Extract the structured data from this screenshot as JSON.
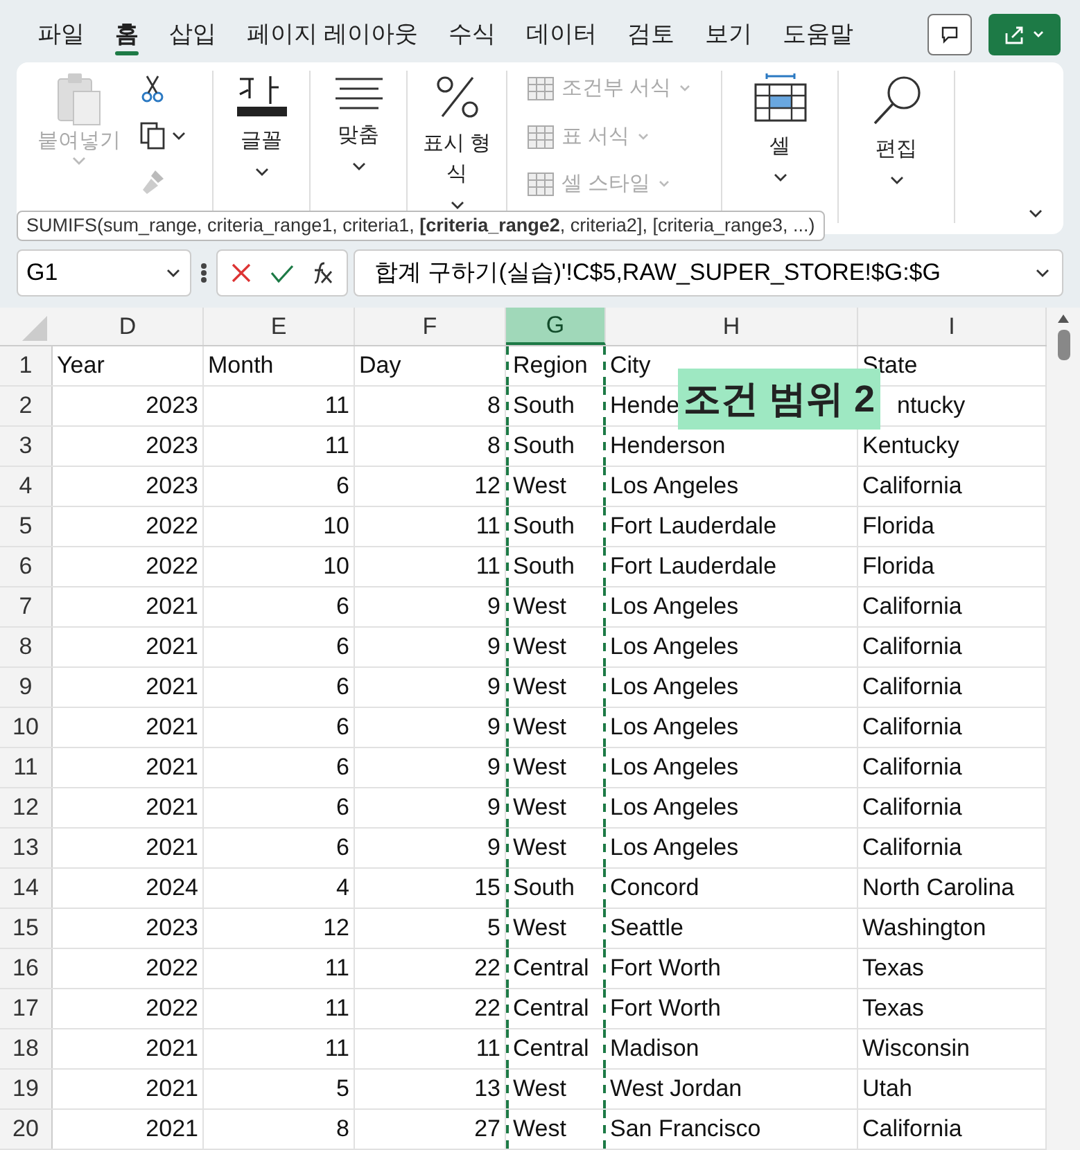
{
  "menu_tabs": [
    {
      "label": "파일",
      "selected": false
    },
    {
      "label": "홈",
      "selected": true
    },
    {
      "label": "삽입",
      "selected": false
    },
    {
      "label": "페이지 레이아웃",
      "selected": false
    },
    {
      "label": "수식",
      "selected": false
    },
    {
      "label": "데이터",
      "selected": false
    },
    {
      "label": "검토",
      "selected": false
    },
    {
      "label": "보기",
      "selected": false
    },
    {
      "label": "도움말",
      "selected": false
    }
  ],
  "ribbon": {
    "paste": {
      "label": "붙여넣기",
      "disabled": true
    },
    "groups": [
      {
        "label": "글꼴"
      },
      {
        "label": "맞춤"
      },
      {
        "label": "표시 형식"
      }
    ],
    "styles": [
      {
        "label": "조건부 서식",
        "disabled": true
      },
      {
        "label": "표 서식",
        "disabled": true
      },
      {
        "label": "셀 스타일",
        "disabled": true
      }
    ],
    "right_groups": [
      {
        "label": "셀"
      },
      {
        "label": "편집"
      }
    ]
  },
  "tooltip": "SUMIFS(sum_range, criteria_range1, criteria1, **[criteria_range2**, criteria2], [criteria_range3, ...)",
  "name_box": "G1",
  "formula": "합계 구하기(실습)'!C$5,RAW_SUPER_STORE!$G:$G",
  "columns": [
    {
      "label": "D",
      "selected": false
    },
    {
      "label": "E",
      "selected": false
    },
    {
      "label": "F",
      "selected": false
    },
    {
      "label": "G",
      "selected": true
    },
    {
      "label": "H",
      "selected": false
    },
    {
      "label": "I",
      "selected": false
    }
  ],
  "rows": [
    {
      "n": "1",
      "cells": [
        "Year",
        "Month",
        "Day",
        "Region",
        "City",
        "State"
      ]
    },
    {
      "n": "2",
      "cells": [
        "2023",
        "11",
        "8",
        "South",
        "Hende",
        "ntucky"
      ]
    },
    {
      "n": "3",
      "cells": [
        "2023",
        "11",
        "8",
        "South",
        "Henderson",
        "Kentucky"
      ]
    },
    {
      "n": "4",
      "cells": [
        "2023",
        "6",
        "12",
        "West",
        "Los Angeles",
        "California"
      ]
    },
    {
      "n": "5",
      "cells": [
        "2022",
        "10",
        "11",
        "South",
        "Fort Lauderdale",
        "Florida"
      ]
    },
    {
      "n": "6",
      "cells": [
        "2022",
        "10",
        "11",
        "South",
        "Fort Lauderdale",
        "Florida"
      ]
    },
    {
      "n": "7",
      "cells": [
        "2021",
        "6",
        "9",
        "West",
        "Los Angeles",
        "California"
      ]
    },
    {
      "n": "8",
      "cells": [
        "2021",
        "6",
        "9",
        "West",
        "Los Angeles",
        "California"
      ]
    },
    {
      "n": "9",
      "cells": [
        "2021",
        "6",
        "9",
        "West",
        "Los Angeles",
        "California"
      ]
    },
    {
      "n": "10",
      "cells": [
        "2021",
        "6",
        "9",
        "West",
        "Los Angeles",
        "California"
      ]
    },
    {
      "n": "11",
      "cells": [
        "2021",
        "6",
        "9",
        "West",
        "Los Angeles",
        "California"
      ]
    },
    {
      "n": "12",
      "cells": [
        "2021",
        "6",
        "9",
        "West",
        "Los Angeles",
        "California"
      ]
    },
    {
      "n": "13",
      "cells": [
        "2021",
        "6",
        "9",
        "West",
        "Los Angeles",
        "California"
      ]
    },
    {
      "n": "14",
      "cells": [
        "2024",
        "4",
        "15",
        "South",
        "Concord",
        "North Carolina"
      ]
    },
    {
      "n": "15",
      "cells": [
        "2023",
        "12",
        "5",
        "West",
        "Seattle",
        "Washington"
      ]
    },
    {
      "n": "16",
      "cells": [
        "2022",
        "11",
        "22",
        "Central",
        "Fort Worth",
        "Texas"
      ]
    },
    {
      "n": "17",
      "cells": [
        "2022",
        "11",
        "22",
        "Central",
        "Fort Worth",
        "Texas"
      ]
    },
    {
      "n": "18",
      "cells": [
        "2021",
        "11",
        "11",
        "Central",
        "Madison",
        "Wisconsin"
      ]
    },
    {
      "n": "19",
      "cells": [
        "2021",
        "5",
        "13",
        "West",
        "West Jordan",
        "Utah"
      ]
    },
    {
      "n": "20",
      "cells": [
        "2021",
        "8",
        "27",
        "West",
        "San Francisco",
        "California"
      ]
    }
  ],
  "callout": "조건 범위 2"
}
